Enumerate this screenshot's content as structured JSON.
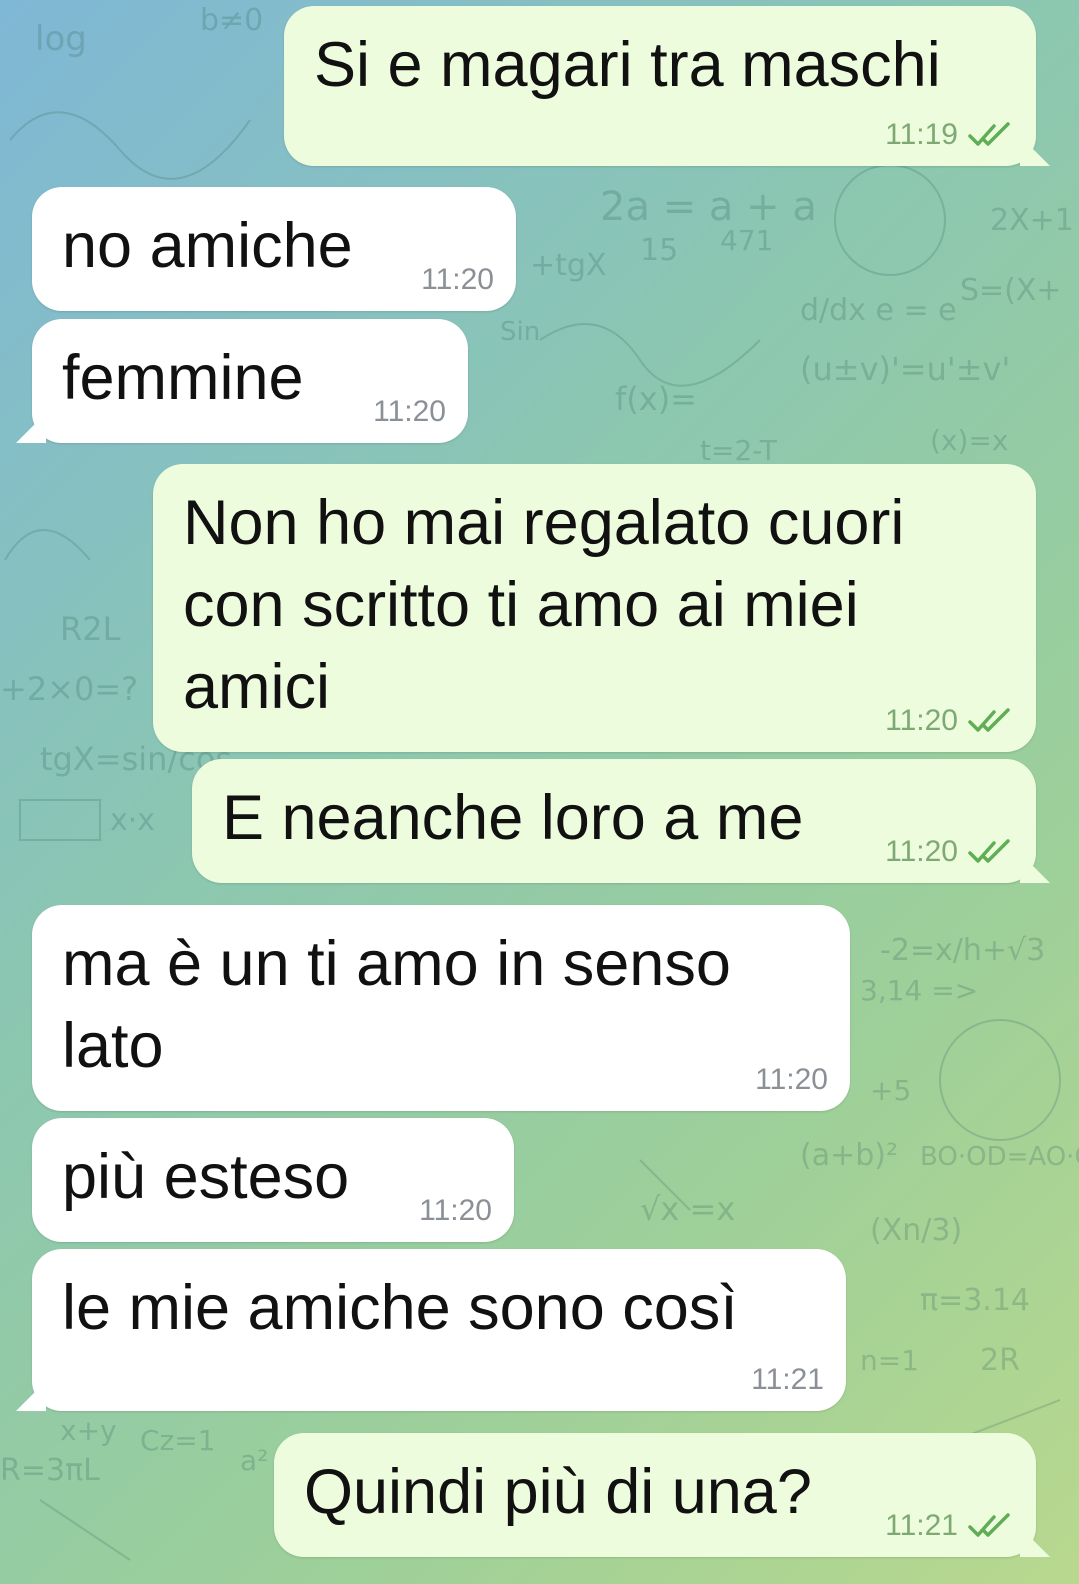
{
  "messages": [
    {
      "text": "Si e magari tra maschi",
      "time": "11:19",
      "direction": "out"
    },
    {
      "text": "no amiche",
      "time": "11:20",
      "direction": "in"
    },
    {
      "text": "femmine",
      "time": "11:20",
      "direction": "in"
    },
    {
      "text": "Non ho mai regalato cuori\ncon scritto ti amo ai miei\namici",
      "time": "11:20",
      "direction": "out"
    },
    {
      "text": "E neanche loro a me",
      "time": "11:20",
      "direction": "out"
    },
    {
      "text": "ma è un ti amo in senso\nlato",
      "time": "11:20",
      "direction": "in"
    },
    {
      "text": "più esteso",
      "time": "11:20",
      "direction": "in"
    },
    {
      "text": "le mie amiche sono così",
      "time": "11:21",
      "direction": "in"
    },
    {
      "text": "Quindi più di una?",
      "time": "11:21",
      "direction": "out"
    }
  ],
  "colors": {
    "incoming_bubble": "#ffffff",
    "outgoing_bubble": "#eefcde",
    "read_check": "#5fae55"
  },
  "icons": {
    "read_status": "double-check-icon"
  }
}
